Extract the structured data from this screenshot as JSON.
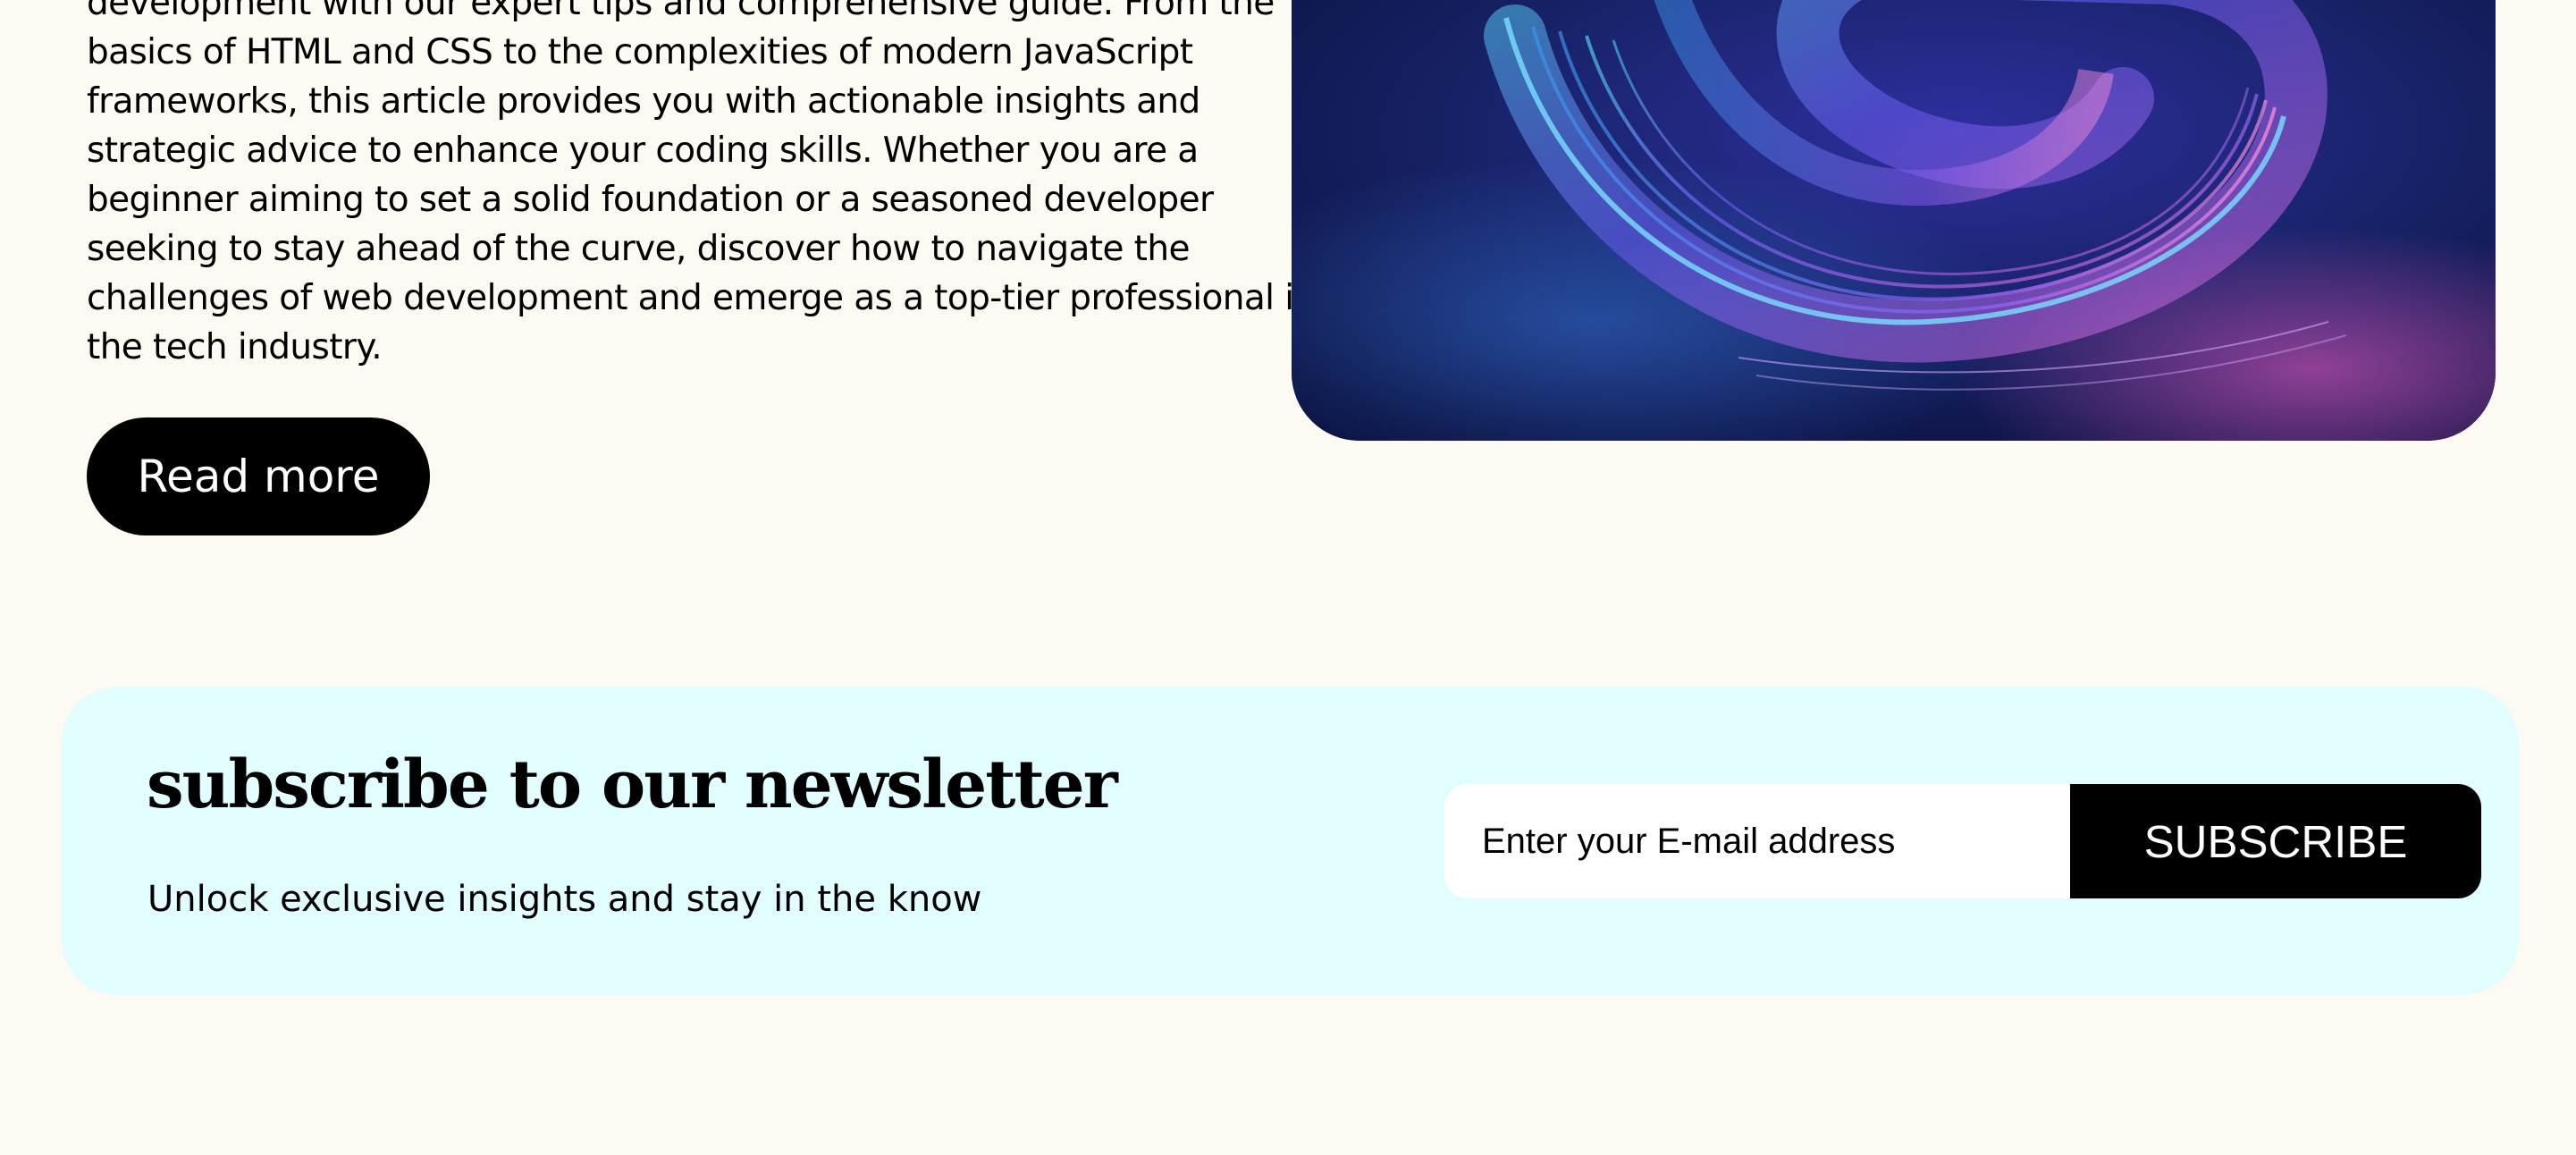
{
  "article": {
    "intro": "development with our expert tips and comprehensive guide. From the\nbasics of HTML and CSS to the complexities of modern JavaScript\nframeworks, this article provides you with actionable insights and\nstrategic advice to enhance your coding skills. Whether you are a\nbeginner aiming to set a solid foundation or a seasoned developer\nseeking to stay ahead of the curve, discover how to navigate the\nchallenges of web development and emerge as a top-tier professional in\nthe tech industry.",
    "read_more_label": "Read more"
  },
  "newsletter": {
    "title": "subscribe to our newsletter",
    "subtitle": "Unlock exclusive insights and stay in the know",
    "email_placeholder": "Enter your E-mail address",
    "email_value": "",
    "subscribe_label": "SUBSCRIBE"
  },
  "colors": {
    "page_background": "#fdfaf3",
    "newsletter_background": "#e2fdfd",
    "button_background": "#000000",
    "button_text": "#ffffff"
  }
}
